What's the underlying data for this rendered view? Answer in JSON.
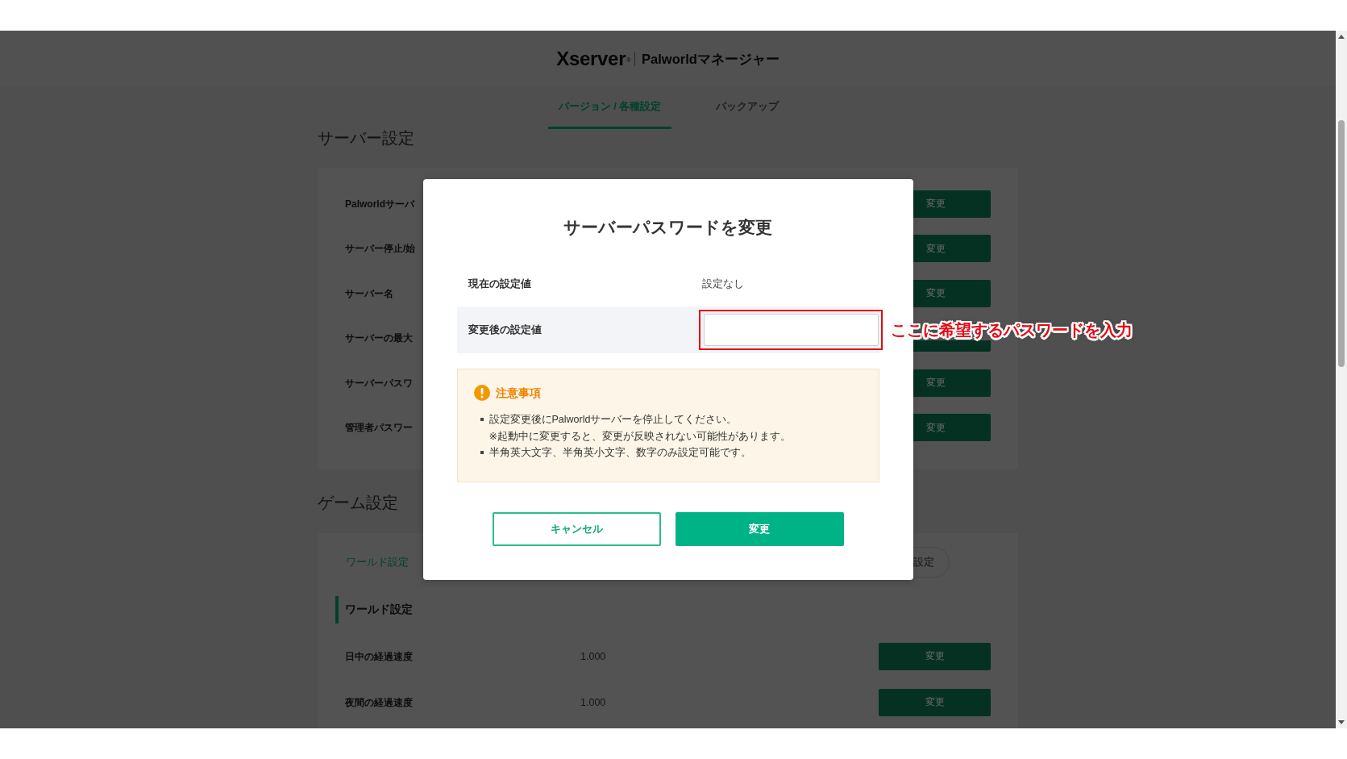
{
  "header": {
    "brand": "Xserver$^{®}$",
    "product": "Palworldマネージャー"
  },
  "tabs": [
    {
      "label": "バージョン / 各種設定",
      "selected": true
    },
    {
      "label": "バックアップ",
      "selected": false
    }
  ],
  "server_settings": {
    "title": "サーバー設定",
    "rows": [
      {
        "label": "Palworldサーバ",
        "button": "変更"
      },
      {
        "label": "サーバー停止/始",
        "button": "変更"
      },
      {
        "label": "サーバー名",
        "button": "変更"
      },
      {
        "label": "サーバーの最大"
      },
      {
        "label": "サーバーパスワ",
        "button": "変更"
      },
      {
        "label": "管理者パスワー",
        "button": "変更"
      }
    ]
  },
  "game_settings": {
    "title": "ゲーム設定",
    "subtabs": [
      {
        "label": "ワールド設定",
        "selected": true
      },
      {
        "label": "設定",
        "selected": false
      }
    ],
    "section_title": "ワールド設定",
    "rows": [
      {
        "label": "日中の経過速度",
        "value": "1.000",
        "button": "変更"
      },
      {
        "label": "夜間の経過速度",
        "value": "1.000",
        "button": "変更"
      }
    ]
  },
  "dialog": {
    "title": "サーバーパスワードを変更",
    "fields": [
      {
        "label": "現在の設定値",
        "kind": "text",
        "value": "設定なし"
      },
      {
        "label": "変更後の設定値",
        "kind": "input"
      }
    ],
    "notice": {
      "title": "注意事項",
      "items": [
        {
          "text": "設定変更後にPalworldサーバーを停止してください。",
          "note": "※起動中に変更すると、変更が反映されない可能性があります。"
        },
        {
          "text": "半角英大文字、半角英小文字、数字のみ設定可能です。"
        }
      ]
    },
    "buttons": [
      {
        "label": "キャンセル",
        "kind": "secondary"
      },
      {
        "label": "変更",
        "kind": "primary"
      }
    ]
  },
  "annotation": {
    "text": "ここに希望するパスワードを入力"
  }
}
